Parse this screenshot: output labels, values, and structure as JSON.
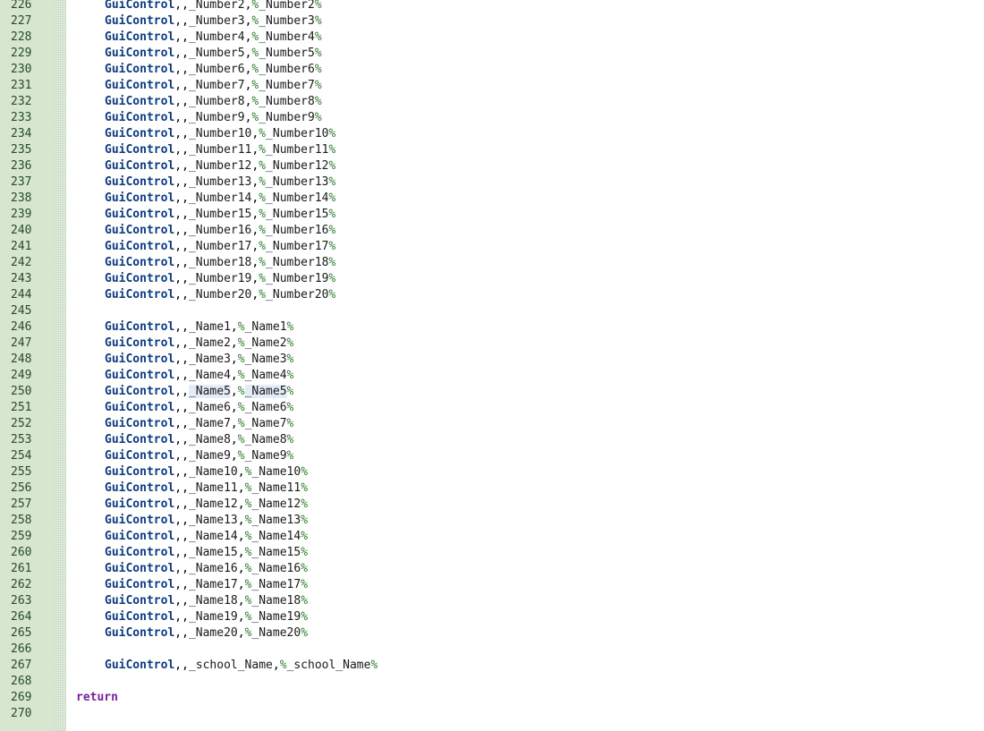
{
  "editor": {
    "colors": {
      "keyword": "#0b3a82",
      "return_keyword": "#7a1fa0",
      "percent": "#2f7d2f",
      "gutter": "#d6e6cf",
      "highlight": "#e4edf7"
    },
    "lines": [
      {
        "n": "226",
        "kind": "gc",
        "cmd": "GuiControl",
        "ctrl": "_Number2",
        "var": "_Number2"
      },
      {
        "n": "227",
        "kind": "gc",
        "cmd": "GuiControl",
        "ctrl": "_Number3",
        "var": "_Number3"
      },
      {
        "n": "228",
        "kind": "gc",
        "cmd": "GuiControl",
        "ctrl": "_Number4",
        "var": "_Number4"
      },
      {
        "n": "229",
        "kind": "gc",
        "cmd": "GuiControl",
        "ctrl": "_Number5",
        "var": "_Number5"
      },
      {
        "n": "230",
        "kind": "gc",
        "cmd": "GuiControl",
        "ctrl": "_Number6",
        "var": "_Number6"
      },
      {
        "n": "231",
        "kind": "gc",
        "cmd": "GuiControl",
        "ctrl": "_Number7",
        "var": "_Number7"
      },
      {
        "n": "232",
        "kind": "gc",
        "cmd": "GuiControl",
        "ctrl": "_Number8",
        "var": "_Number8"
      },
      {
        "n": "233",
        "kind": "gc",
        "cmd": "GuiControl",
        "ctrl": "_Number9",
        "var": "_Number9"
      },
      {
        "n": "234",
        "kind": "gc",
        "cmd": "GuiControl",
        "ctrl": "_Number10",
        "var": "_Number10"
      },
      {
        "n": "235",
        "kind": "gc",
        "cmd": "GuiControl",
        "ctrl": "_Number11",
        "var": "_Number11"
      },
      {
        "n": "236",
        "kind": "gc",
        "cmd": "GuiControl",
        "ctrl": "_Number12",
        "var": "_Number12"
      },
      {
        "n": "237",
        "kind": "gc",
        "cmd": "GuiControl",
        "ctrl": "_Number13",
        "var": "_Number13"
      },
      {
        "n": "238",
        "kind": "gc",
        "cmd": "GuiControl",
        "ctrl": "_Number14",
        "var": "_Number14"
      },
      {
        "n": "239",
        "kind": "gc",
        "cmd": "GuiControl",
        "ctrl": "_Number15",
        "var": "_Number15"
      },
      {
        "n": "240",
        "kind": "gc",
        "cmd": "GuiControl",
        "ctrl": "_Number16",
        "var": "_Number16"
      },
      {
        "n": "241",
        "kind": "gc",
        "cmd": "GuiControl",
        "ctrl": "_Number17",
        "var": "_Number17"
      },
      {
        "n": "242",
        "kind": "gc",
        "cmd": "GuiControl",
        "ctrl": "_Number18",
        "var": "_Number18"
      },
      {
        "n": "243",
        "kind": "gc",
        "cmd": "GuiControl",
        "ctrl": "_Number19",
        "var": "_Number19"
      },
      {
        "n": "244",
        "kind": "gc",
        "cmd": "GuiControl",
        "ctrl": "_Number20",
        "var": "_Number20"
      },
      {
        "n": "245",
        "kind": "blank"
      },
      {
        "n": "246",
        "kind": "gc",
        "cmd": "GuiControl",
        "ctrl": "_Name1",
        "var": "_Name1"
      },
      {
        "n": "247",
        "kind": "gc",
        "cmd": "GuiControl",
        "ctrl": "_Name2",
        "var": "_Name2"
      },
      {
        "n": "248",
        "kind": "gc",
        "cmd": "GuiControl",
        "ctrl": "_Name3",
        "var": "_Name3"
      },
      {
        "n": "249",
        "kind": "gc",
        "cmd": "GuiControl",
        "ctrl": "_Name4",
        "var": "_Name4"
      },
      {
        "n": "250",
        "kind": "gc",
        "cmd": "GuiControl",
        "ctrl": "_Name5",
        "var": "_Name5",
        "highlight": true
      },
      {
        "n": "251",
        "kind": "gc",
        "cmd": "GuiControl",
        "ctrl": "_Name6",
        "var": "_Name6"
      },
      {
        "n": "252",
        "kind": "gc",
        "cmd": "GuiControl",
        "ctrl": "_Name7",
        "var": "_Name7"
      },
      {
        "n": "253",
        "kind": "gc",
        "cmd": "GuiControl",
        "ctrl": "_Name8",
        "var": "_Name8"
      },
      {
        "n": "254",
        "kind": "gc",
        "cmd": "GuiControl",
        "ctrl": "_Name9",
        "var": "_Name9"
      },
      {
        "n": "255",
        "kind": "gc",
        "cmd": "GuiControl",
        "ctrl": "_Name10",
        "var": "_Name10"
      },
      {
        "n": "256",
        "kind": "gc",
        "cmd": "GuiControl",
        "ctrl": "_Name11",
        "var": "_Name11"
      },
      {
        "n": "257",
        "kind": "gc",
        "cmd": "GuiControl",
        "ctrl": "_Name12",
        "var": "_Name12"
      },
      {
        "n": "258",
        "kind": "gc",
        "cmd": "GuiControl",
        "ctrl": "_Name13",
        "var": "_Name13"
      },
      {
        "n": "259",
        "kind": "gc",
        "cmd": "GuiControl",
        "ctrl": "_Name14",
        "var": "_Name14"
      },
      {
        "n": "260",
        "kind": "gc",
        "cmd": "GuiControl",
        "ctrl": "_Name15",
        "var": "_Name15"
      },
      {
        "n": "261",
        "kind": "gc",
        "cmd": "GuiControl",
        "ctrl": "_Name16",
        "var": "_Name16"
      },
      {
        "n": "262",
        "kind": "gc",
        "cmd": "GuiControl",
        "ctrl": "_Name17",
        "var": "_Name17"
      },
      {
        "n": "263",
        "kind": "gc",
        "cmd": "GuiControl",
        "ctrl": "_Name18",
        "var": "_Name18"
      },
      {
        "n": "264",
        "kind": "gc",
        "cmd": "GuiControl",
        "ctrl": "_Name19",
        "var": "_Name19"
      },
      {
        "n": "265",
        "kind": "gc",
        "cmd": "GuiControl",
        "ctrl": "_Name20",
        "var": "_Name20"
      },
      {
        "n": "266",
        "kind": "blank"
      },
      {
        "n": "267",
        "kind": "gc",
        "cmd": "GuiControl",
        "ctrl": "_school_Name",
        "var": "_school_Name"
      },
      {
        "n": "268",
        "kind": "blank"
      },
      {
        "n": "269",
        "kind": "return",
        "cmd": "return"
      },
      {
        "n": "270",
        "kind": "blank"
      }
    ]
  }
}
